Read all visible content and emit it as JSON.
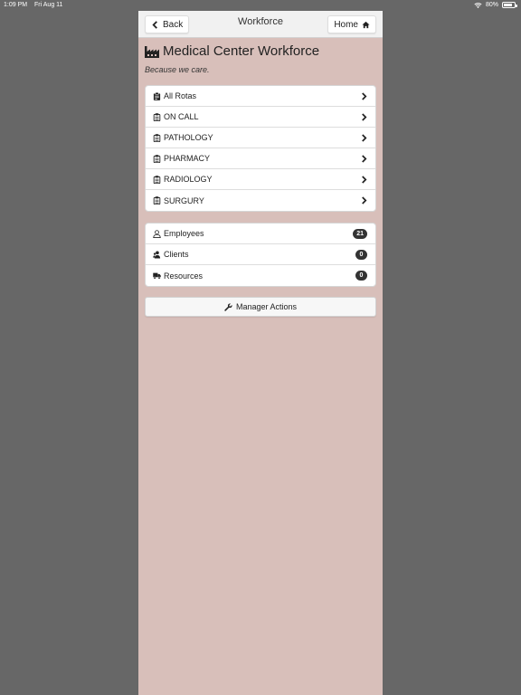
{
  "status_bar": {
    "time": "1:09 PM",
    "date": "Fri Aug 11",
    "battery_text": "80%",
    "battery_level": 0.8
  },
  "header": {
    "title": "Workforce",
    "back_label": "Back",
    "home_label": "Home"
  },
  "page": {
    "title": "Medical Center Workforce",
    "tagline": "Because we care."
  },
  "rotas": [
    {
      "label": "All Rotas",
      "icon": "clipboard-filled-icon"
    },
    {
      "label": "ON CALL",
      "icon": "clipboard-icon"
    },
    {
      "label": "PATHOLOGY",
      "icon": "clipboard-icon"
    },
    {
      "label": "PHARMACY",
      "icon": "clipboard-icon"
    },
    {
      "label": "RADIOLOGY",
      "icon": "clipboard-icon"
    },
    {
      "label": "SURGURY",
      "icon": "clipboard-icon"
    }
  ],
  "counts": [
    {
      "label": "Employees",
      "count": "21",
      "icon": "user-icon"
    },
    {
      "label": "Clients",
      "count": "0",
      "icon": "users-icon"
    },
    {
      "label": "Resources",
      "count": "0",
      "icon": "truck-icon"
    }
  ],
  "manager_actions": {
    "label": "Manager Actions",
    "icon": "wrench-icon"
  },
  "colors": {
    "background": "#676767",
    "app_background": "#d8bfba",
    "badge": "#333333"
  }
}
